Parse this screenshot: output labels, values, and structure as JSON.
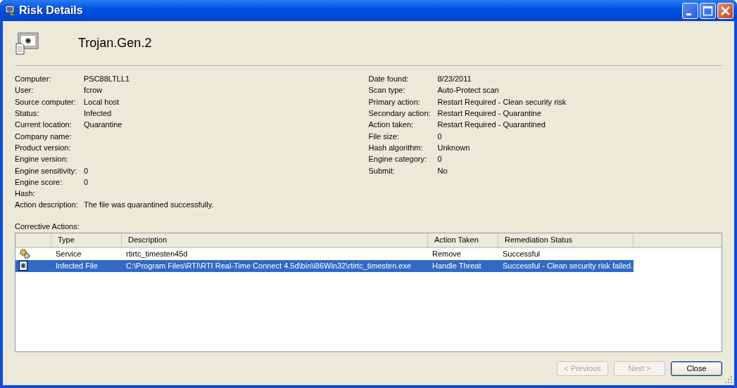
{
  "window": {
    "title": "Risk Details"
  },
  "risk_name": "Trojan.Gen.2",
  "details_left": [
    {
      "label": "Computer:",
      "value": "PSC88LTLL1"
    },
    {
      "label": "User:",
      "value": "fcrow"
    },
    {
      "label": "Source computer:",
      "value": "Local host"
    },
    {
      "label": "Status:",
      "value": "Infected"
    },
    {
      "label": "Current location:",
      "value": "Quarantine"
    },
    {
      "label": "Company name:"
    },
    {
      "label": "Product version:"
    },
    {
      "label": "Engine version:"
    },
    {
      "label": "Engine sensitivity:",
      "value": "0"
    },
    {
      "label": "Engine score:",
      "value": "0"
    },
    {
      "label": "Hash:"
    },
    {
      "label": "Action description:",
      "value": "The file was quarantined successfully."
    }
  ],
  "details_right": [
    {
      "label": "Date found:",
      "value": "8/23/2011"
    },
    {
      "label": "Scan type:",
      "value": "Auto-Protect scan"
    },
    {
      "label": "Primary action:",
      "value": "Restart Required - Clean security risk"
    },
    {
      "label": "Secondary action:",
      "value": "Restart Required - Quarantine"
    },
    {
      "label": "Action taken:",
      "value": "Restart Required - Quarantined"
    },
    {
      "label": "File size:",
      "value": "0"
    },
    {
      "label": "Hash algorithm:",
      "value": "Unknown"
    },
    {
      "label": "Engine category:",
      "value": "0"
    },
    {
      "label": "Submit:",
      "value": "No"
    }
  ],
  "corrective_actions": {
    "label": "Corrective Actions:",
    "columns": [
      "Type",
      "Description",
      "Action Taken",
      "Remediation Status"
    ],
    "rows": [
      {
        "kind": "service",
        "selected": false,
        "cells": [
          "Service",
          "rtirtc_timesten45d",
          "Remove",
          "Successful"
        ]
      },
      {
        "kind": "file",
        "selected": true,
        "cells": [
          "Infected File",
          "C:\\Program Files\\RTI\\RTI Real-Time Connect 4.5d\\bin\\i86Win32\\rtirtc_timesten.exe",
          "Handle Threat",
          "Successful - Clean security risk failed."
        ]
      }
    ]
  },
  "buttons": [
    {
      "label": "< Previous",
      "disabled": true
    },
    {
      "label": "Next >",
      "disabled": true
    },
    {
      "label": "Close",
      "disabled": false
    }
  ]
}
